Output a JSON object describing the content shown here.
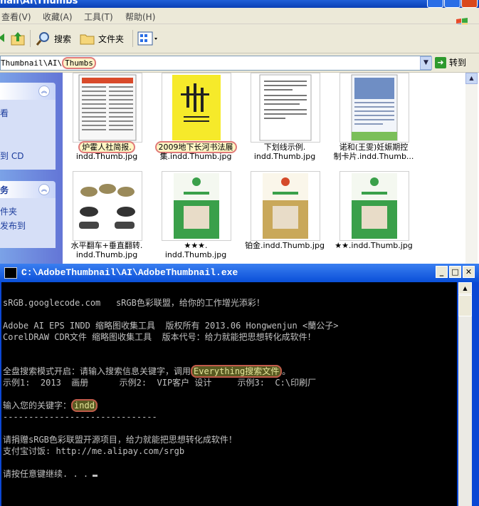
{
  "explorer": {
    "window_title": "nail\\AI\\Thumbs",
    "menu": [
      "查看(V)",
      "收藏(A)",
      "工具(T)",
      "帮助(H)"
    ],
    "toolbar": {
      "search": "搜索",
      "folders": "文件夹"
    },
    "address": {
      "path": "Thumbnail\\AI\\",
      "current": "Thumbs"
    },
    "go_label": "转到",
    "left_pane": {
      "lines": [
        "看",
        "到 CD",
        "务",
        "件夹",
        "发布到"
      ]
    },
    "files": [
      {
        "line1": "炉霍人社简报.",
        "line2": "indd.Thumb.jpg",
        "highlight": true
      },
      {
        "line1": "2009地下长河书法展",
        "line2": "集.indd.Thumb.jpg",
        "highlight": true
      },
      {
        "line1": "下划线示例.",
        "line2": "indd.Thumb.jpg",
        "highlight": false
      },
      {
        "line1": "诺和(王雯)妊娠期控",
        "line2": "制卡片.indd.Thumb...",
        "highlight": false
      },
      {
        "line1": "水平翻车+垂直翻转.",
        "line2": "indd.Thumb.jpg",
        "highlight": false
      },
      {
        "line1": "★★★.",
        "line2": "indd.Thumb.jpg",
        "highlight": false
      },
      {
        "line1": "铂金.indd.Thumb.jpg",
        "line2": "",
        "highlight": false
      },
      {
        "line1": "★★.indd.Thumb.jpg",
        "line2": "",
        "highlight": false
      }
    ]
  },
  "console": {
    "title": "C:\\AdobeThumbnail\\AI\\AdobeThumbnail.exe",
    "line1": "sRGB.googlecode.com   sRGB色彩联盟，给你的工作增光添彩！",
    "line2": "Adobe AI EPS INDD 缩略图收集工具  版权所有 2013.06 Hongwenjun <蘭公子>",
    "line3": "CorelDRAW CDR文件 缩略图收集工具  版本代号：给力就能把思想转化成软件！",
    "line4_pre": "全盘搜索模式开启：请输入搜索信息关键字，调用",
    "line4_kw": "Everything搜索文件",
    "line4_post": "。",
    "line5": "示例1:  2013  画册      示例2:  VIP客户 设计     示例3:  C:\\印刷厂",
    "line6_pre": "输入您的关键字：",
    "line6_kw": "indd",
    "line7": "------------------------------",
    "line8": "请捐赠sRGB色彩联盟开源项目，给力就能把思想转化成软件！",
    "line9": "支付宝讨饭: http://me.alipay.com/srgb",
    "line10": "请按任意键继续. . ."
  }
}
